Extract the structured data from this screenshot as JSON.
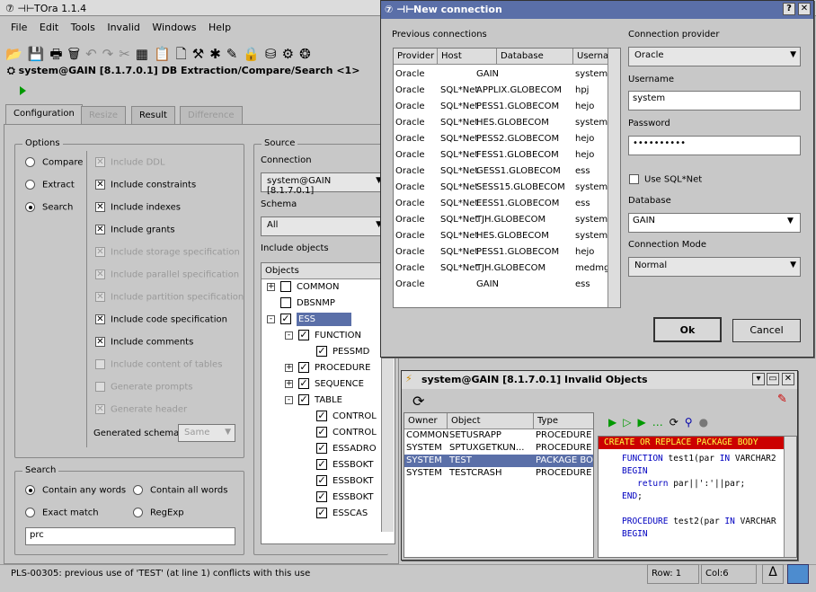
{
  "main": {
    "title": "TOra 1.1.4",
    "menu": [
      "File",
      "Edit",
      "Tools",
      "Invalid",
      "Windows",
      "Help"
    ],
    "doc_title": "system@GAIN [8.1.7.0.1] DB Extraction/Compare/Search <1>",
    "tabs": [
      "Configuration",
      "Resize",
      "Result",
      "Difference"
    ],
    "options_label": "Options",
    "modes": [
      "Compare",
      "Extract",
      "Search"
    ],
    "include": [
      {
        "label": "Include DDL",
        "checked": true,
        "enabled": false
      },
      {
        "label": "Include constraints",
        "checked": true,
        "enabled": true
      },
      {
        "label": "Include indexes",
        "checked": true,
        "enabled": true
      },
      {
        "label": "Include grants",
        "checked": true,
        "enabled": true
      },
      {
        "label": "Include storage specification",
        "checked": true,
        "enabled": false
      },
      {
        "label": "Include parallel specification",
        "checked": true,
        "enabled": false
      },
      {
        "label": "Include partition specification",
        "checked": true,
        "enabled": false
      },
      {
        "label": "Include code specification",
        "checked": true,
        "enabled": true
      },
      {
        "label": "Include comments",
        "checked": true,
        "enabled": true
      },
      {
        "label": "Include content of tables",
        "checked": false,
        "enabled": false
      },
      {
        "label": "Generate prompts",
        "checked": false,
        "enabled": false
      },
      {
        "label": "Generate header",
        "checked": true,
        "enabled": false
      }
    ],
    "generated_schema_label": "Generated schema",
    "generated_schema_value": "Same",
    "search_label": "Search",
    "search_opts": [
      "Contain any words",
      "Contain all words",
      "Exact match",
      "RegExp"
    ],
    "search_value": "prc",
    "source_label": "Source",
    "connection_label": "Connection",
    "connection_value": "system@GAIN [8.1.7.0.1]",
    "schema_label": "Schema",
    "schema_value": "All",
    "include_objects_label": "Include objects",
    "objects_header": "Objects",
    "tree": [
      {
        "label": "COMMON",
        "level": 0,
        "exp": "+",
        "checked": false
      },
      {
        "label": "DBSNMP",
        "level": 0,
        "exp": "",
        "checked": false
      },
      {
        "label": "ESS",
        "level": 0,
        "exp": "-",
        "checked": true,
        "selected": true
      },
      {
        "label": "FUNCTION",
        "level": 1,
        "exp": "-",
        "checked": true
      },
      {
        "label": "PESSMD",
        "level": 2,
        "exp": "",
        "checked": true
      },
      {
        "label": "PROCEDURE",
        "level": 1,
        "exp": "+",
        "checked": true
      },
      {
        "label": "SEQUENCE",
        "level": 1,
        "exp": "+",
        "checked": true
      },
      {
        "label": "TABLE",
        "level": 1,
        "exp": "-",
        "checked": true
      },
      {
        "label": "CONTROL",
        "level": 2,
        "exp": "",
        "checked": true
      },
      {
        "label": "CONTROL",
        "level": 2,
        "exp": "",
        "checked": true
      },
      {
        "label": "ESSADRO",
        "level": 2,
        "exp": "",
        "checked": true
      },
      {
        "label": "ESSBOKT",
        "level": 2,
        "exp": "",
        "checked": true
      },
      {
        "label": "ESSBOKT",
        "level": 2,
        "exp": "",
        "checked": true
      },
      {
        "label": "ESSBOKT",
        "level": 2,
        "exp": "",
        "checked": true
      },
      {
        "label": "ESSCAS",
        "level": 2,
        "exp": "",
        "checked": true
      }
    ],
    "status": "PLS-00305: previous use of 'TEST' (at line 1) conflicts with this use",
    "row_label": "Row: 1",
    "col_label": "Col:6"
  },
  "conn": {
    "title": "New connection",
    "prev_label": "Previous connections",
    "headers": [
      "Provider",
      "Host",
      "Database",
      "Userna"
    ],
    "rows": [
      [
        "Oracle",
        "",
        "GAIN",
        "system"
      ],
      [
        "Oracle",
        "SQL*Net",
        "APPLIX.GLOBECOM",
        "hpj"
      ],
      [
        "Oracle",
        "SQL*Net",
        "PESS1.GLOBECOM",
        "hejo"
      ],
      [
        "Oracle",
        "SQL*Net",
        "HES.GLOBECOM",
        "system"
      ],
      [
        "Oracle",
        "SQL*Net",
        "PESS2.GLOBECOM",
        "hejo"
      ],
      [
        "Oracle",
        "SQL*Net",
        "FESS1.GLOBECOM",
        "hejo"
      ],
      [
        "Oracle",
        "SQL*Net",
        "GESS1.GLOBECOM",
        "ess"
      ],
      [
        "Oracle",
        "SQL*Net",
        "SESS15.GLOBECOM",
        "system"
      ],
      [
        "Oracle",
        "SQL*Net",
        "EESS1.GLOBECOM",
        "ess"
      ],
      [
        "Oracle",
        "SQL*Net",
        "TJH.GLOBECOM",
        "system"
      ],
      [
        "Oracle",
        "SQL*Net",
        "HES.GLOBECOM",
        "system"
      ],
      [
        "Oracle",
        "SQL*Net",
        "PESS1.GLOBECOM",
        "hejo"
      ],
      [
        "Oracle",
        "SQL*Net",
        "TJH.GLOBECOM",
        "medmgr"
      ],
      [
        "Oracle",
        "",
        "GAIN",
        "ess"
      ]
    ],
    "provider_label": "Connection provider",
    "provider_value": "Oracle",
    "username_label": "Username",
    "username_value": "system",
    "password_label": "Password",
    "password_value": "••••••••••",
    "sqlnet_label": "Use SQL*Net",
    "database_label": "Database",
    "database_value": "GAIN",
    "mode_label": "Connection Mode",
    "mode_value": "Normal",
    "ok": "Ok",
    "cancel": "Cancel"
  },
  "invalid": {
    "title": "system@GAIN [8.1.7.0.1] Invalid Objects",
    "headers": [
      "Owner",
      "Object",
      "Type"
    ],
    "rows": [
      [
        "COMMON",
        "SETUSRAPP",
        "PROCEDURE"
      ],
      [
        "SYSTEM",
        "SPTUXGETKUN...",
        "PROCEDURE"
      ],
      [
        "SYSTEM",
        "TEST",
        "PACKAGE BO"
      ],
      [
        "SYSTEM",
        "TESTCRASH",
        "PROCEDURE"
      ]
    ],
    "code_header": "CREATE OR REPLACE PACKAGE BODY",
    "code": [
      {
        "kw": "FUNCTION",
        "rest": " test1(par ",
        "kw2": "IN",
        "rest2": " VARCHAR2"
      },
      {
        "kw": "BEGIN",
        "rest": "",
        "kw2": "",
        "rest2": ""
      },
      {
        "kw": "   return",
        "rest": " par||':'||par;",
        "kw2": "",
        "rest2": ""
      },
      {
        "kw": "END",
        "rest": ";",
        "kw2": "",
        "rest2": ""
      },
      {
        "kw": "",
        "rest": "",
        "kw2": "",
        "rest2": ""
      },
      {
        "kw": "PROCEDURE",
        "rest": " test2(par ",
        "kw2": "IN",
        "rest2": " VARCHAR"
      },
      {
        "kw": "BEGIN",
        "rest": "",
        "kw2": "",
        "rest2": ""
      }
    ]
  }
}
